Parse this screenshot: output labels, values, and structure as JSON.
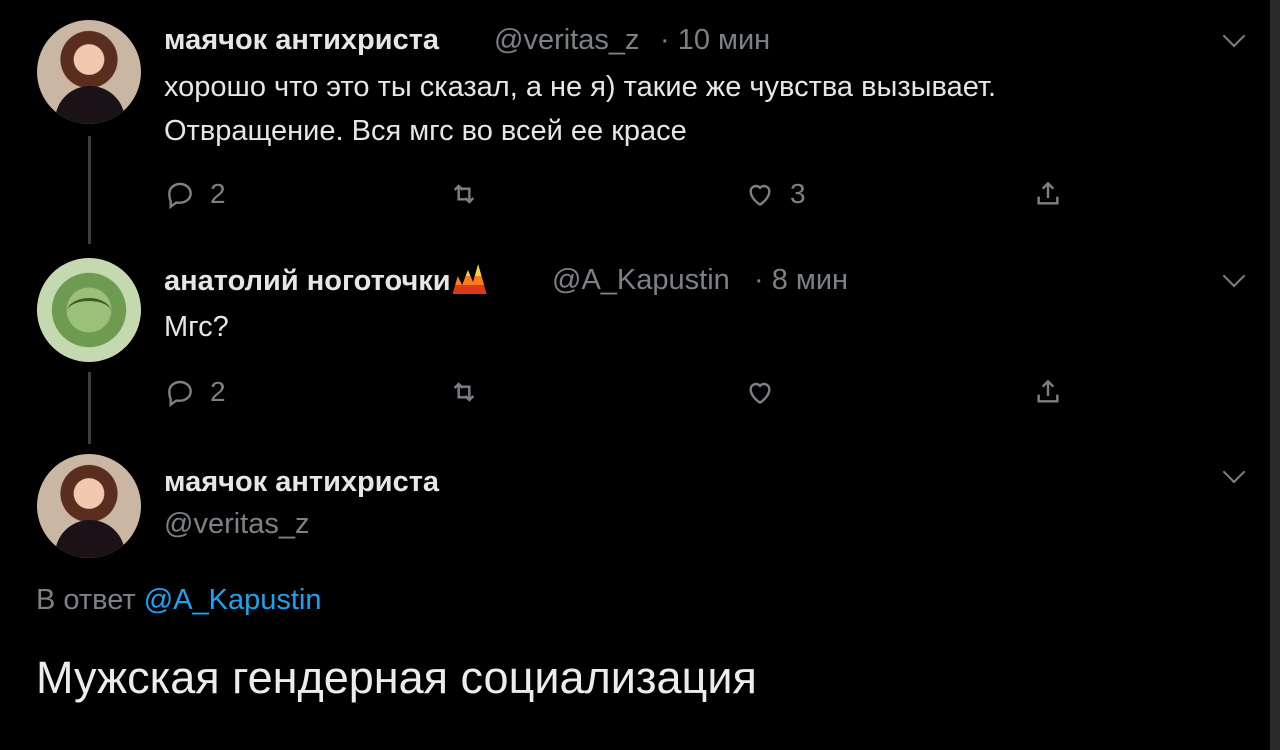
{
  "colors": {
    "background": "#000000",
    "text": "#e6e6e6",
    "secondary": "#7b8185",
    "link": "#1da1f2",
    "thread_line": "#3a3f44"
  },
  "tweets": [
    {
      "display_name": "маячок антихриста",
      "handle": "@veritas_z",
      "time": "· 10 мин",
      "lines": [
        "хорошо что это ты сказал, а не я) такие же чувства вызывает.",
        "Отвращение. Вся мгс во всей ее красе"
      ],
      "replies": "2",
      "retweets": "",
      "likes": "3",
      "icons": [
        "reply-icon",
        "retweet-icon",
        "like-icon",
        "share-icon",
        "chevron-down-icon"
      ]
    },
    {
      "display_name": "анатолий ноготочки",
      "handle": "@A_Kapustin",
      "time": "· 8 мин",
      "lines": [
        "Мгс?"
      ],
      "replies": "2",
      "retweets": "",
      "likes": "",
      "icons": [
        "reply-icon",
        "retweet-icon",
        "like-icon",
        "share-icon",
        "chevron-down-icon"
      ]
    }
  ],
  "focused": {
    "display_name": "маячок антихриста",
    "handle": "@veritas_z",
    "reply_prefix": "В ответ ",
    "reply_mention": "@A_Kapustin",
    "text": "Мужская гендерная социализация"
  }
}
